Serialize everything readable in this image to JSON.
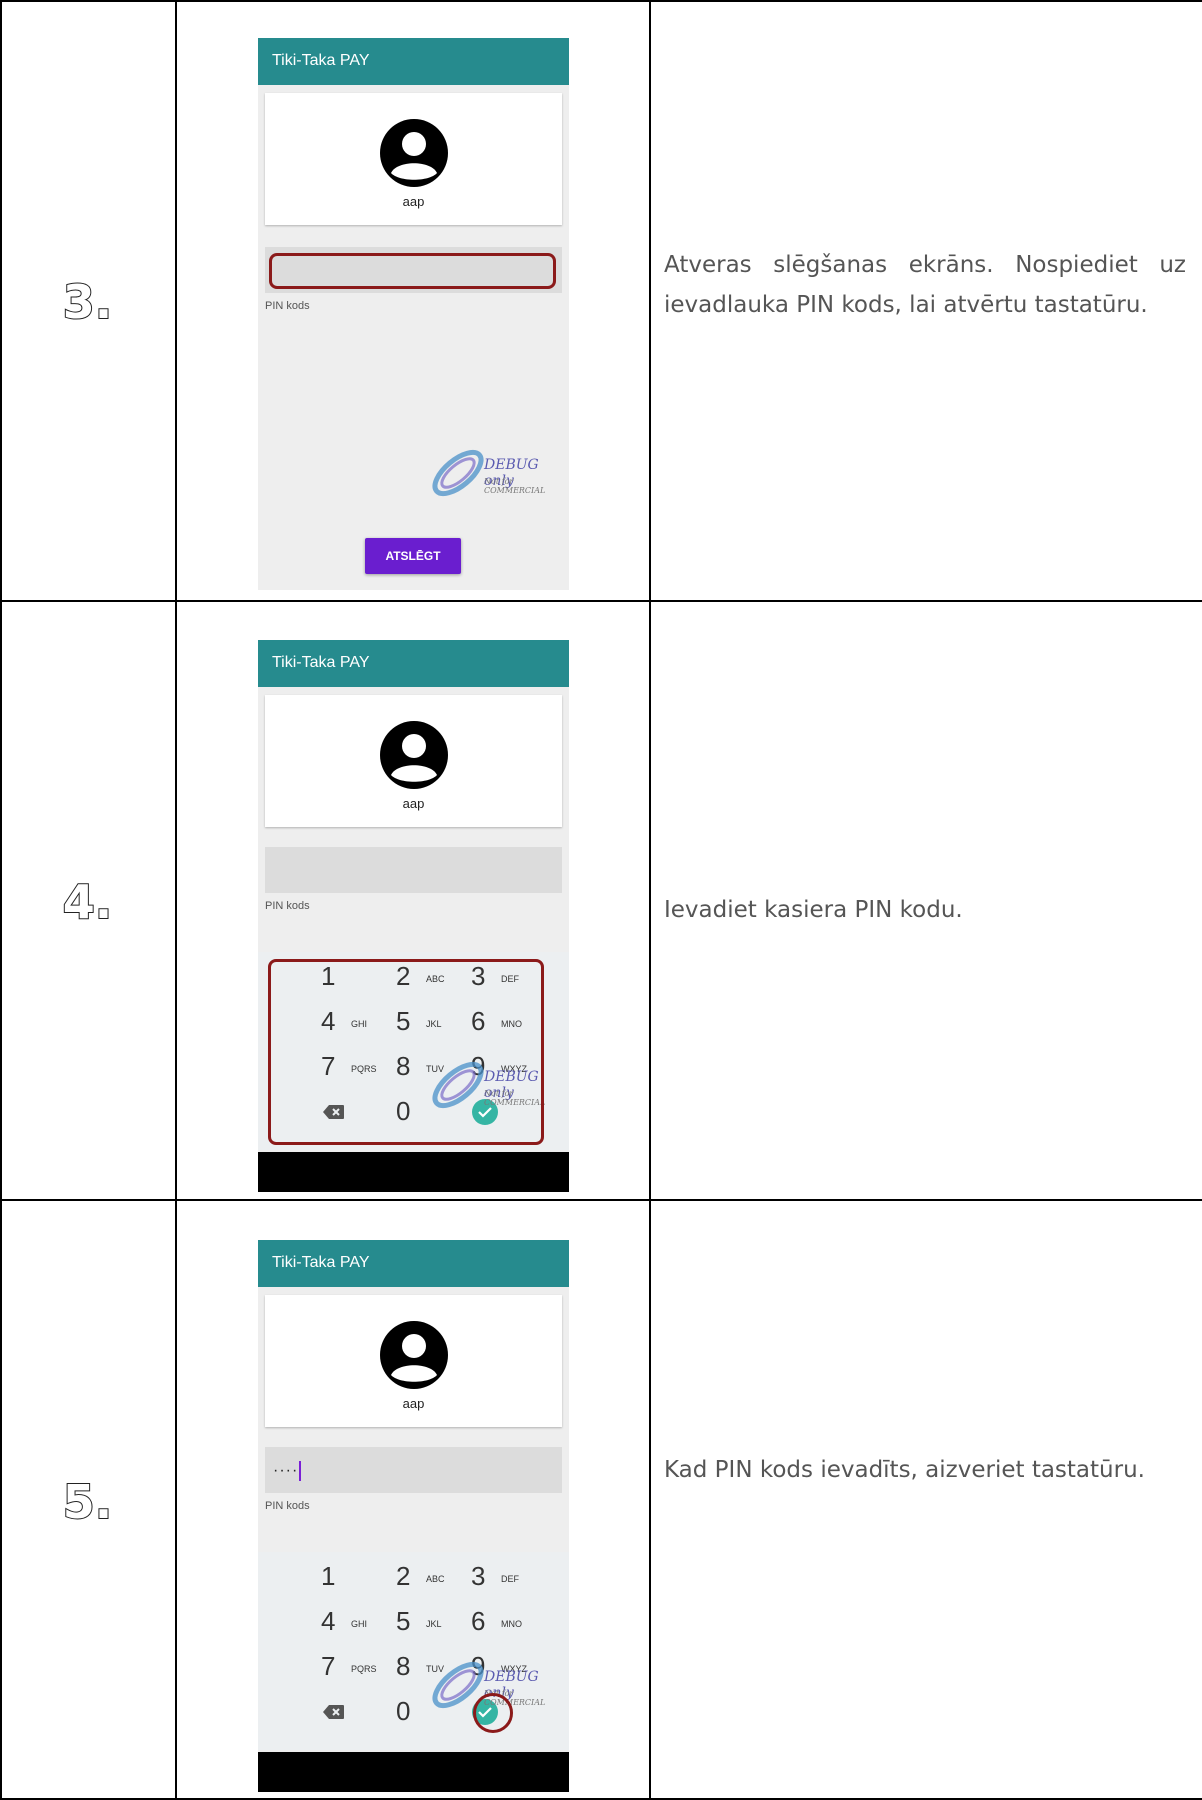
{
  "rows": [
    {
      "step": "3.",
      "description": "Atveras slēgšanas ekrāns. Nospiediet uz ievadlauka PIN kods, lai atvērtu tastatūru.",
      "phone": {
        "title": "Tiki-Taka PAY",
        "username": "aap",
        "pin_value": "",
        "pin_label": "PIN kods",
        "button_label": "ATSLĒGT",
        "watermark_main": "DEBUG only",
        "watermark_sub": "Not for COMMERCIAL"
      }
    },
    {
      "step": "4.",
      "description": "Ievadiet kasiera PIN kodu.",
      "phone": {
        "title": "Tiki-Taka PAY",
        "username": "aap",
        "pin_value": "",
        "pin_label": "PIN kods",
        "watermark_main": "DEBUG only",
        "watermark_sub": "Not for COMMERCIAL"
      }
    },
    {
      "step": "5.",
      "description": "Kad PIN kods ievadīts, aizveriet tastatūru.",
      "phone": {
        "title": "Tiki-Taka PAY",
        "username": "aap",
        "pin_value": "····",
        "pin_label": "PIN kods",
        "watermark_main": "DEBUG only",
        "watermark_sub": "Not for COMMERCIAL"
      }
    }
  ],
  "keypad": {
    "keys": [
      {
        "digit": "1",
        "letters": ""
      },
      {
        "digit": "2",
        "letters": "ABC"
      },
      {
        "digit": "3",
        "letters": "DEF"
      },
      {
        "digit": "4",
        "letters": "GHI"
      },
      {
        "digit": "5",
        "letters": "JKL"
      },
      {
        "digit": "6",
        "letters": "MNO"
      },
      {
        "digit": "7",
        "letters": "PQRS"
      },
      {
        "digit": "8",
        "letters": "TUV"
      },
      {
        "digit": "9",
        "letters": "WXYZ"
      },
      {
        "digit": "0",
        "letters": ""
      }
    ],
    "backspace_icon": "backspace-icon",
    "confirm_icon": "check-circle-icon",
    "confirm_color": "#35b5a4"
  },
  "colors": {
    "appbar": "#268b8e",
    "button": "#6a1ecf",
    "highlight": "#8b1a1a"
  }
}
